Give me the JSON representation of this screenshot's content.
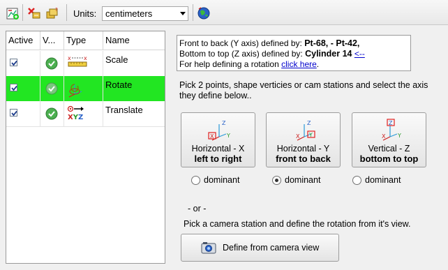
{
  "toolbar": {
    "units_label": "Units:",
    "units_value": "centimeters",
    "buttons": [
      "add-transform-icon",
      "delete-transform-icon",
      "copy-transform-icon",
      "globe-icon"
    ]
  },
  "list": {
    "columns": [
      "Active",
      "V...",
      "Type",
      "Name"
    ],
    "rows": [
      {
        "name": "Scale",
        "active": true,
        "valid": true,
        "type_icon": "scale-icon",
        "selected": false
      },
      {
        "name": "Rotate",
        "active": true,
        "valid": true,
        "type_icon": "rotate-icon",
        "selected": true
      },
      {
        "name": "Translate",
        "active": true,
        "valid": true,
        "type_icon": "translate-icon",
        "selected": false
      }
    ],
    "translate_axes": "XYZ"
  },
  "info": {
    "line1_prefix": "Front to back (Y axis) defined by:",
    "line1_value": "Pt-68, -  Pt-42,",
    "line2_prefix": "Bottom to top (Z axis) defined by:",
    "line2_value": "Cylinder 14",
    "line2_link": "<--",
    "line3_prefix": "For help defining a rotation",
    "line3_link": "click here",
    "line3_suffix": "."
  },
  "instructions": "Pick 2 points, shape verticies or cam stations and select the axis they define below..",
  "axis_buttons": [
    {
      "line1": "Horizontal - X",
      "line2": "left to right",
      "dominant": "dominant",
      "selected": false,
      "highlight": "X"
    },
    {
      "line1": "Horizontal - Y",
      "line2": "front to back",
      "dominant": "dominant",
      "selected": true,
      "highlight": "Y"
    },
    {
      "line1": "Vertical - Z",
      "line2": "bottom to top",
      "dominant": "dominant",
      "selected": false,
      "highlight": "Z"
    }
  ],
  "axis_letters": {
    "x": "X",
    "y": "Y",
    "z": "Z"
  },
  "or_text": "- or -",
  "camera_instructions": "Pick a camera station and define the rotation from it's view.",
  "camera_button": "Define from camera view",
  "colors": {
    "selected_row": "#22e622",
    "link": "#0000cc",
    "axis_highlight": "#e02020",
    "check_green": "#4caf50"
  }
}
